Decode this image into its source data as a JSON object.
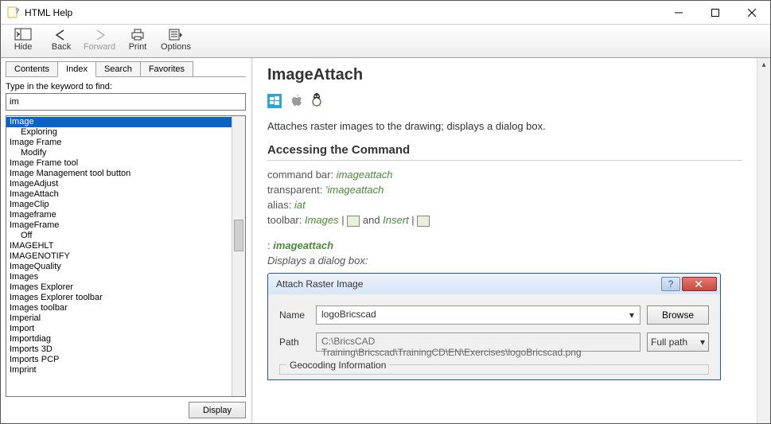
{
  "window": {
    "title": "HTML Help"
  },
  "toolbar": [
    {
      "label": "Hide"
    },
    {
      "label": "Back"
    },
    {
      "label": "Forward"
    },
    {
      "label": "Print"
    },
    {
      "label": "Options"
    }
  ],
  "tabs": {
    "contents": "Contents",
    "index": "Index",
    "search": "Search",
    "favorites": "Favorites"
  },
  "search_label": "Type in the keyword to find:",
  "search_value": "im",
  "index": [
    {
      "t": "Image",
      "sel": true
    },
    {
      "t": "Exploring",
      "sub": true
    },
    {
      "t": "Image Frame"
    },
    {
      "t": "Modify",
      "sub": true
    },
    {
      "t": "Image Frame tool"
    },
    {
      "t": "Image Management tool button"
    },
    {
      "t": "ImageAdjust"
    },
    {
      "t": "ImageAttach"
    },
    {
      "t": "ImageClip"
    },
    {
      "t": "Imageframe"
    },
    {
      "t": "ImageFrame"
    },
    {
      "t": "Off",
      "sub": true
    },
    {
      "t": "IMAGEHLT"
    },
    {
      "t": "IMAGENOTIFY"
    },
    {
      "t": "ImageQuality"
    },
    {
      "t": "Images"
    },
    {
      "t": "Images Explorer"
    },
    {
      "t": "Images Explorer toolbar"
    },
    {
      "t": "Images toolbar"
    },
    {
      "t": "Imperial"
    },
    {
      "t": "Import"
    },
    {
      "t": "Importdiag"
    },
    {
      "t": "Imports 3D"
    },
    {
      "t": "Imports PCP"
    },
    {
      "t": "Imprint"
    }
  ],
  "display_btn": "Display",
  "article": {
    "title": "ImageAttach",
    "intro": "Attaches raster images to the drawing; displays a dialog box.",
    "h2": "Accessing the Command",
    "cmdbar_l": "command bar:  ",
    "cmdbar_v": "imageattach",
    "trans_l": "transparent:  ",
    "trans_v": "'imageattach",
    "alias_l": "alias:  ",
    "alias_v": "iat",
    "toolbar_l": "toolbar:  ",
    "toolbar_v1": "Images",
    "toolbar_sep": " | ",
    "toolbar_and": "  and ",
    "toolbar_v2": "Insert",
    "colon": ": ",
    "cmd": "imageattach",
    "displays": "Displays a dialog box:"
  },
  "dialog": {
    "title": "Attach Raster Image",
    "name_l": "Name",
    "name_v": "logoBricscad",
    "browse": "Browse",
    "path_l": "Path",
    "path_v": "C:\\BricsCAD Training\\Bricscad\\TrainingCD\\EN\\Exercises\\logoBricscad.png",
    "path_mode": "Full path",
    "group": "Geocoding Information"
  }
}
